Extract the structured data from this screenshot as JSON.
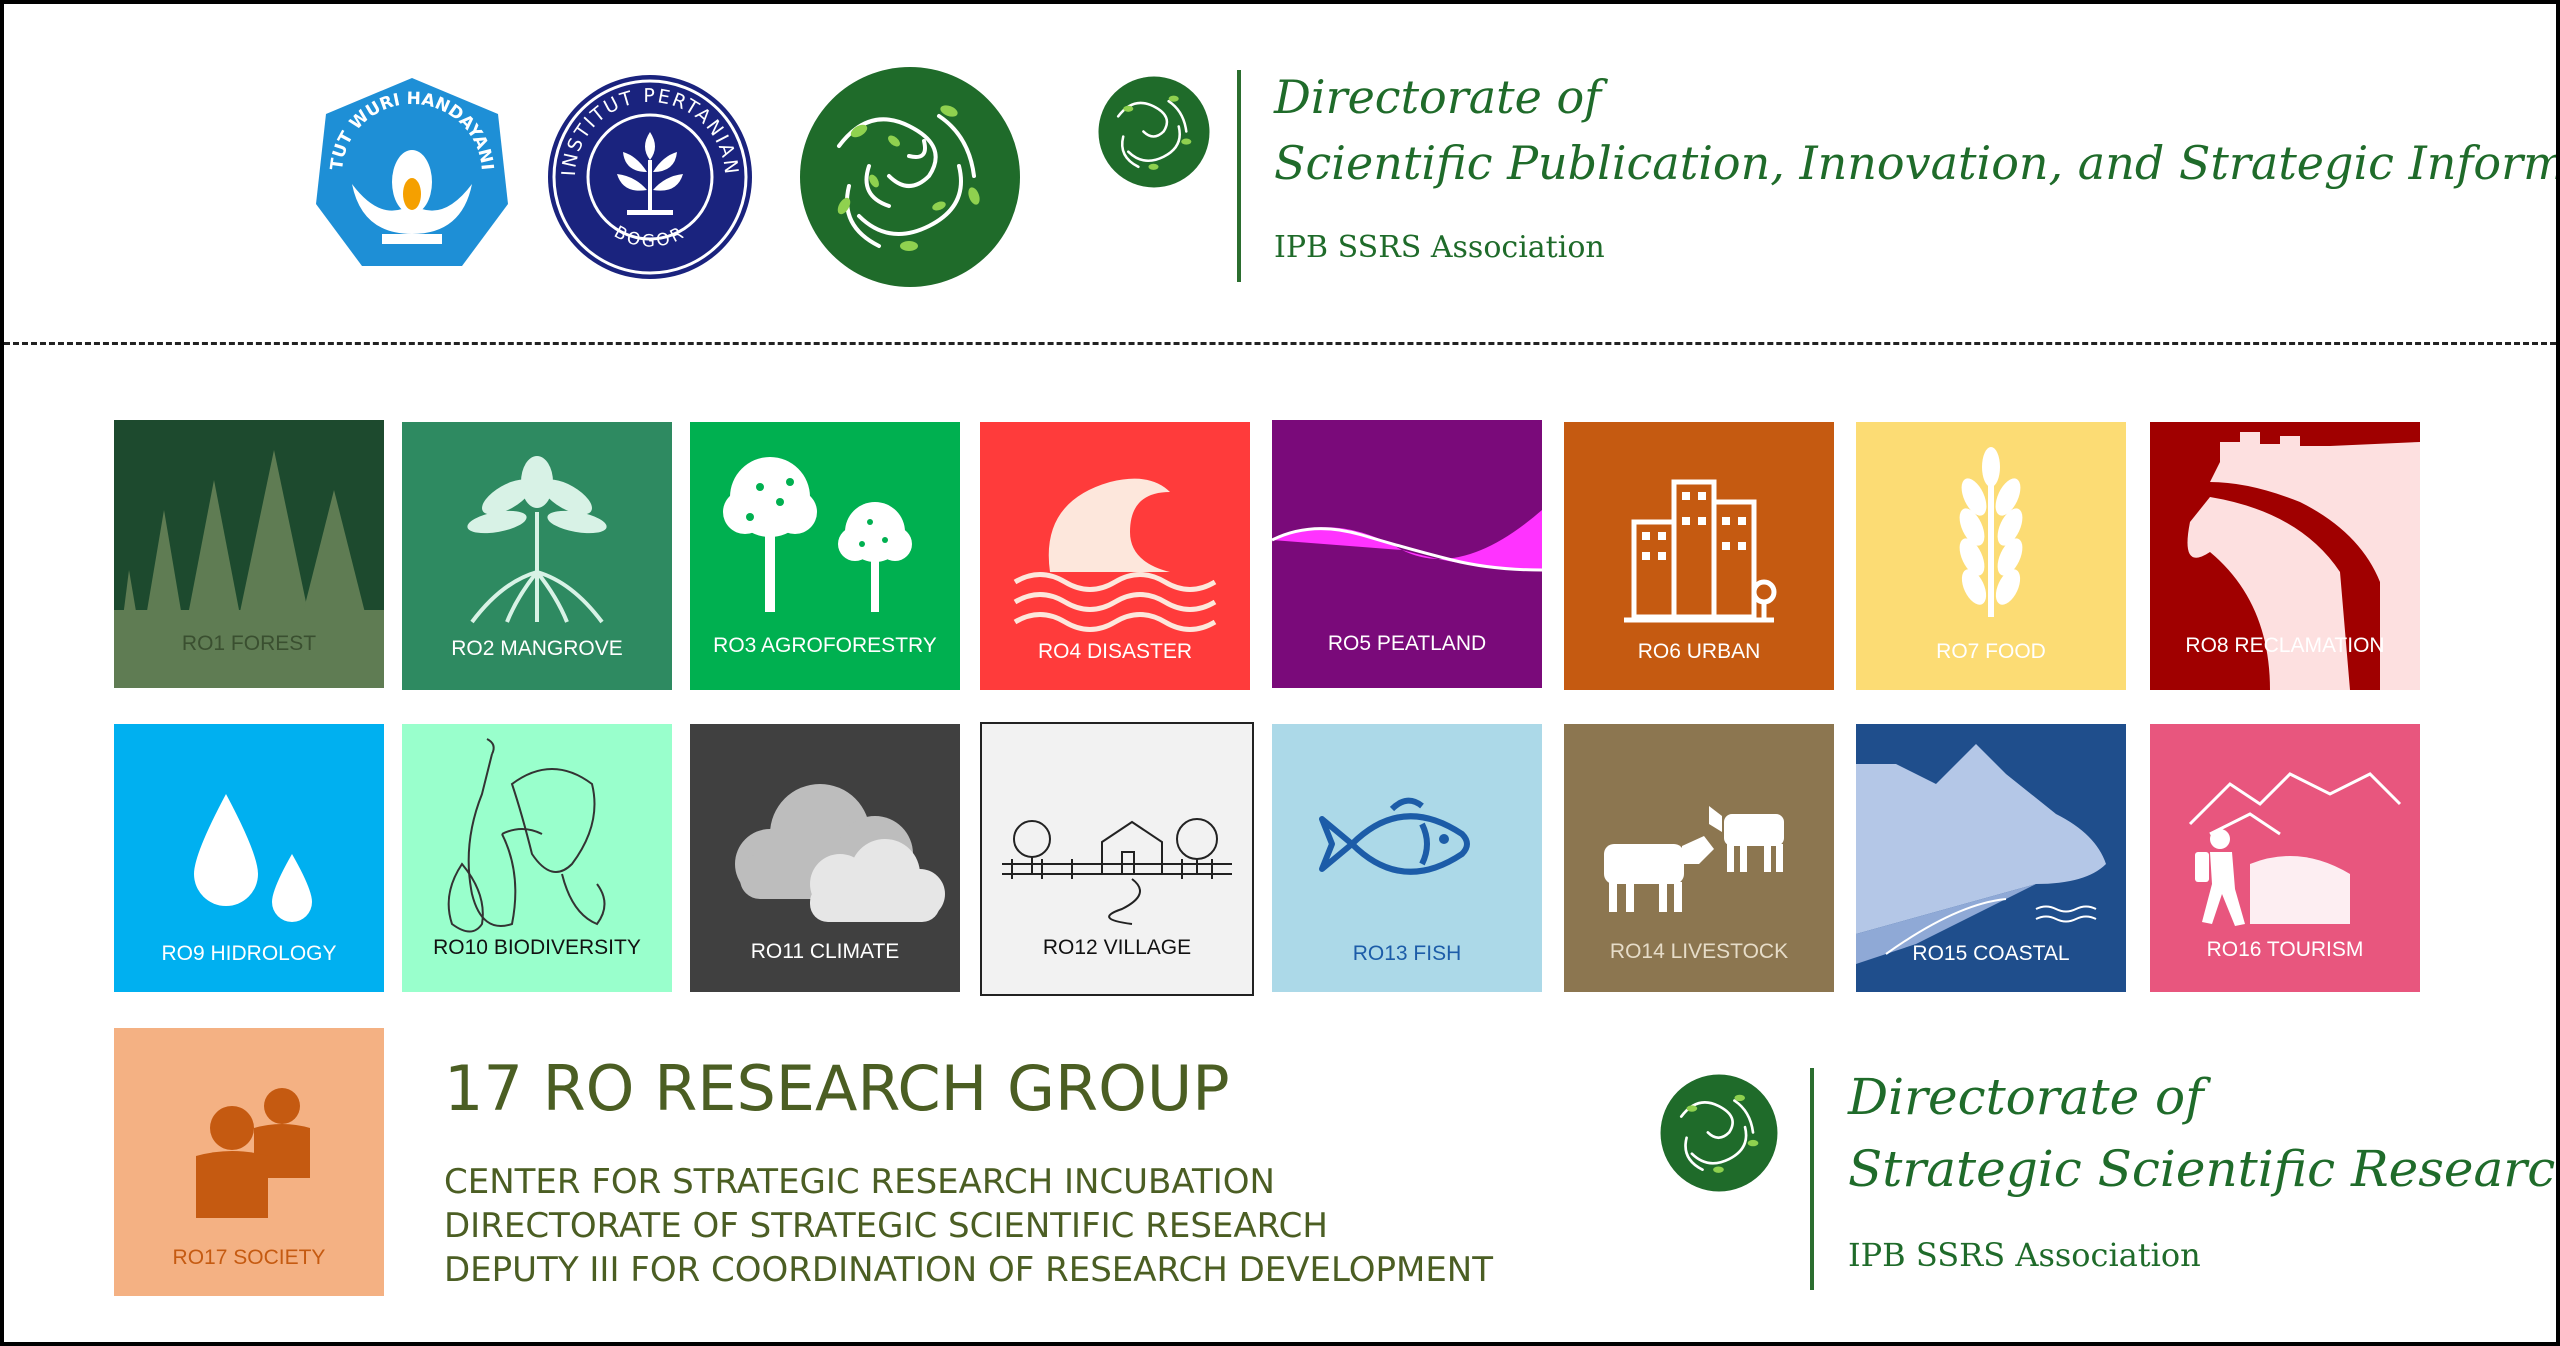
{
  "header": {
    "logos": [
      {
        "name": "kemendikbud-logo",
        "text": "TUT WURI HANDAYANI"
      },
      {
        "name": "ipb-logo",
        "text": "INSTITUT PERTANIAN",
        "text2": "BOGOR"
      },
      {
        "name": "ssrs-logo"
      }
    ],
    "directorate_title_line1": "Directorate of",
    "directorate_title_line2": "Scientific Publication, Innovation, and Strategic Information",
    "directorate_sub": "IPB SSRS Association"
  },
  "tiles": [
    {
      "label": "RO1 FOREST",
      "icon": "forest-icon",
      "color": "#5f7c53"
    },
    {
      "label": "RO2 MANGROVE",
      "icon": "mangrove-icon",
      "color": "#2e8a61"
    },
    {
      "label": "RO3 AGROFORESTRY",
      "icon": "trees-icon",
      "color": "#00b050"
    },
    {
      "label": "RO4 DISASTER",
      "icon": "wave-icon",
      "color": "#ff3b3b"
    },
    {
      "label": "RO5 PEATLAND",
      "icon": "peatland-icon",
      "color": "#7a0a7a"
    },
    {
      "label": "RO6 URBAN",
      "icon": "city-icon",
      "color": "#c55a11"
    },
    {
      "label": "RO7 FOOD",
      "icon": "wheat-icon",
      "color": "#fcdc74"
    },
    {
      "label": "RO8 RECLAMATION",
      "icon": "reclamation-icon",
      "color": "#a00000"
    },
    {
      "label": "RO9 HIDROLOGY",
      "icon": "water-drops-icon",
      "color": "#00b0f0"
    },
    {
      "label": "RO10 BIODIVERSITY",
      "icon": "pitcher-plant-icon",
      "color": "#99ffcc"
    },
    {
      "label": "RO11 CLIMATE",
      "icon": "cloud-icon",
      "color": "#404040"
    },
    {
      "label": "RO12 VILLAGE",
      "icon": "village-icon",
      "color": "#f2f2f2"
    },
    {
      "label": "RO13 FISH",
      "icon": "fish-icon",
      "color": "#acd9e8"
    },
    {
      "label": "RO14 LIVESTOCK",
      "icon": "cattle-icon",
      "color": "#8c7650"
    },
    {
      "label": "RO15 COASTAL",
      "icon": "coastal-icon",
      "color": "#1f4e8c"
    },
    {
      "label": "RO16 TOURISM",
      "icon": "hiker-icon",
      "color": "#e8567e"
    },
    {
      "label": "RO17 SOCIETY",
      "icon": "people-icon",
      "color": "#f4b183"
    }
  ],
  "footer": {
    "title": "17 RO RESEARCH GROUP",
    "lines": [
      "CENTER FOR STRATEGIC RESEARCH INCUBATION",
      "DIRECTORATE OF STRATEGIC SCIENTIFIC RESEARCH",
      "DEPUTY III FOR COORDINATION OF RESEARCH DEVELOPMENT"
    ],
    "directorate_title_line1": "Directorate of",
    "directorate_title_line2": "Strategic Scientific Research",
    "directorate_sub": "IPB SSRS Association"
  }
}
